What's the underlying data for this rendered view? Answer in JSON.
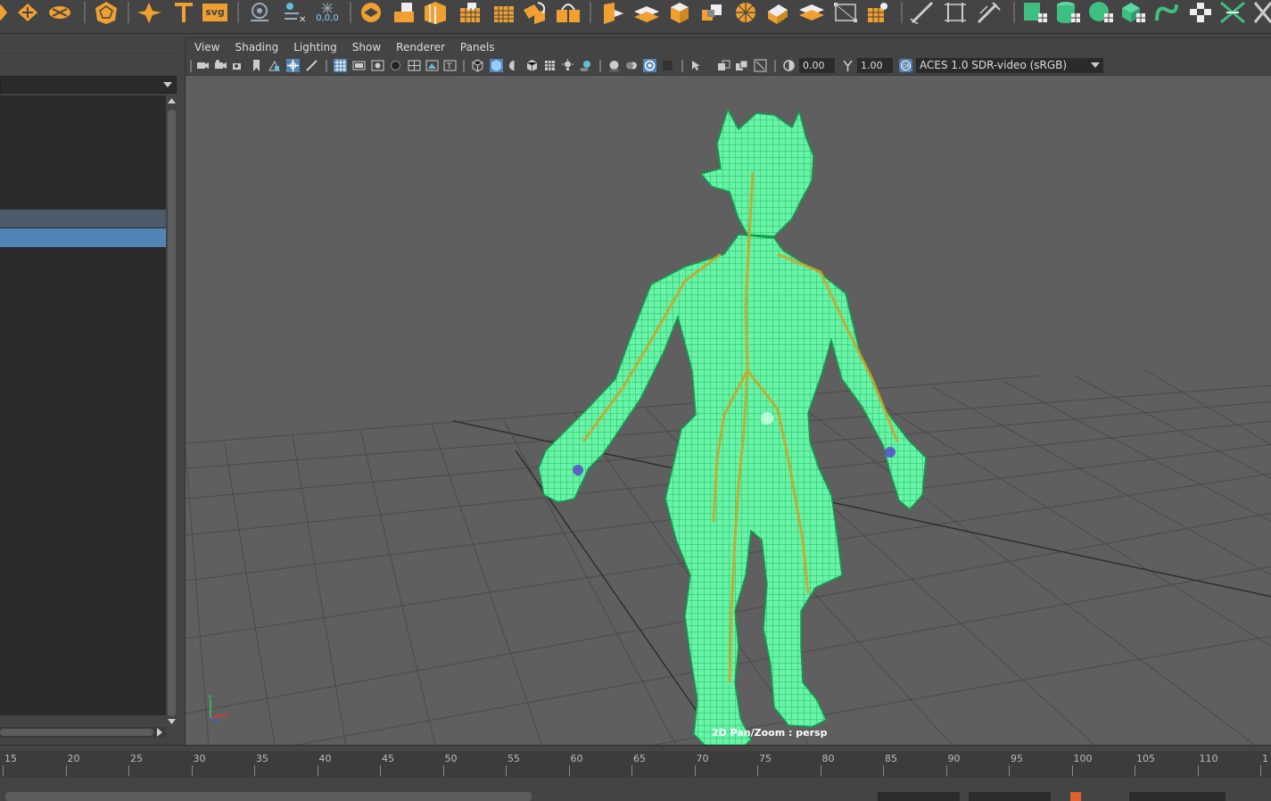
{
  "shelf": {
    "icons": [
      "diamond-icon",
      "diamond-cross-icon",
      "polyhedron-icon",
      "sparkle-icon",
      "text-icon",
      "svg-icon",
      "magnify-icon",
      "node-icon",
      "origin-icon",
      "cube-stack-icon",
      "cube-extrude-icon",
      "cube-split-icon",
      "grid-icon",
      "bevel-icon",
      "bridge-icon",
      "boolean-icon",
      "plane-icon",
      "cube-icon",
      "sphere-icon",
      "fold-icon",
      "transform-icon",
      "crop-icon",
      "array-icon",
      "pen-icon",
      "frame-icon",
      "sculpt-icon",
      "cube-checker-icon",
      "cylinder-checker-icon",
      "sphere-checker-icon",
      "layers-checker-icon",
      "curve-icon",
      "checker-icon",
      "joint-icon"
    ],
    "svg_label": "svg",
    "origin_label": "0,0,0"
  },
  "viewport": {
    "menus": [
      "View",
      "Shading",
      "Lighting",
      "Show",
      "Renderer",
      "Panels"
    ],
    "exposure": "0.00",
    "gamma": "1.00",
    "color_management": "ACES 1.0 SDR-video (sRGB)",
    "hud_label": "2D Pan/Zoom : persp"
  },
  "timeline": {
    "ticks": [
      "15",
      "20",
      "25",
      "30",
      "35",
      "40",
      "45",
      "50",
      "55",
      "60",
      "65",
      "70",
      "75",
      "80",
      "85",
      "90",
      "95",
      "100",
      "105",
      "110",
      "1"
    ]
  },
  "colors": {
    "wireframe": "#3cf28a",
    "skeleton": "#c8a62a",
    "selection": "#5285b6",
    "accent": "#f0a030"
  }
}
